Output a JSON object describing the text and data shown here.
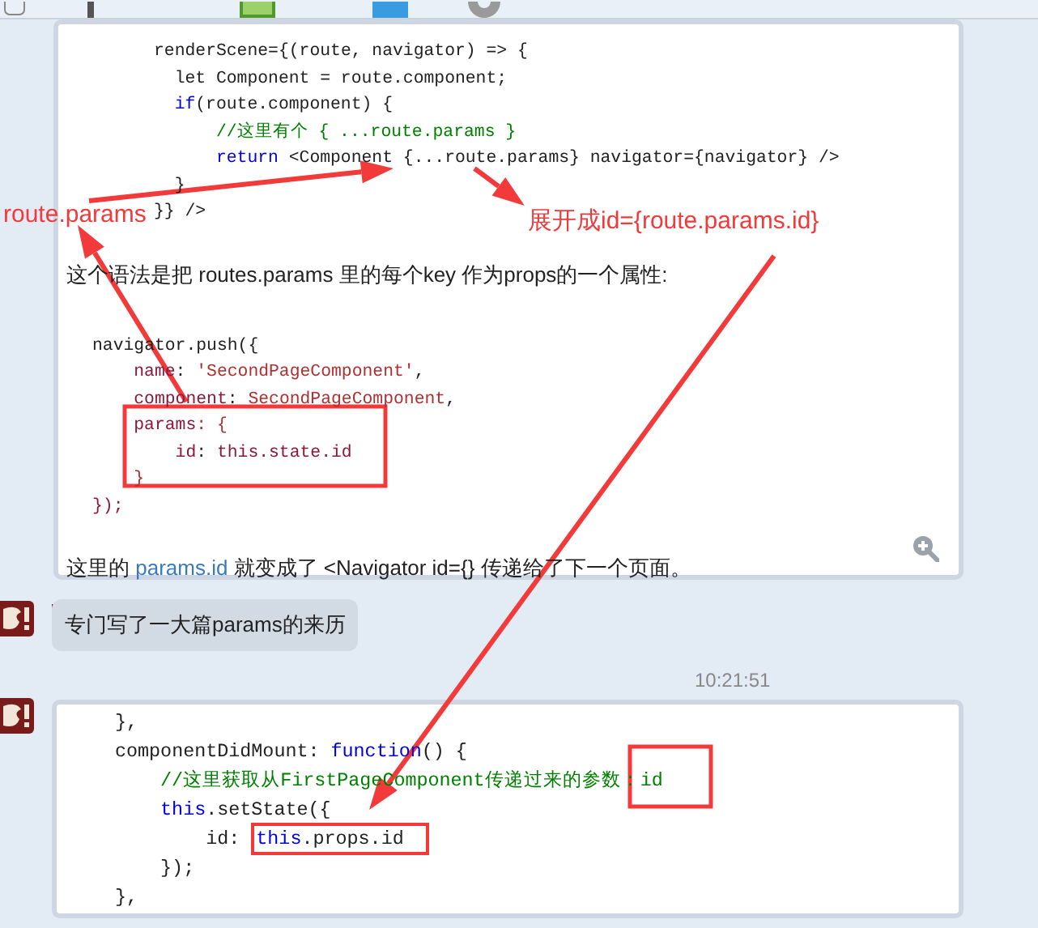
{
  "messages": [
    {
      "kind": "card",
      "blocks": [
        {
          "kind": "code",
          "lines": [
            [
              {
                "text": "renderScene={(route, navigator) => {",
                "kind": "plain"
              }
            ],
            [
              {
                "text": "  let Component = route.component;",
                "kind": "plain"
              }
            ],
            [
              {
                "text": "  if",
                "kind": "keyword"
              },
              {
                "text": "(route.component) {",
                "kind": "plain"
              }
            ],
            [
              {
                "text": "      //这里有个 { ...route.params }",
                "kind": "comment"
              }
            ],
            [
              {
                "text": "      return",
                "kind": "keyword"
              },
              {
                "text": " <Component {...route.params} navigator={navigator} />",
                "kind": "plain"
              }
            ],
            [
              {
                "text": "  }",
                "kind": "plain"
              }
            ],
            [
              {
                "text": "}} />",
                "kind": "plain"
              }
            ]
          ]
        },
        {
          "kind": "text",
          "parts": [
            {
              "text": "这个语法是把 routes.params 里的每个key 作为props的一个属性:",
              "kind": "plain"
            }
          ]
        },
        {
          "kind": "code2",
          "lines": [
            [
              {
                "text": "navigator.push({",
                "kind": "plain"
              }
            ],
            [
              {
                "text": "    name",
                "kind": "prop"
              },
              {
                "text": ": ",
                "kind": "plain"
              },
              {
                "text": "'SecondPageComponent'",
                "kind": "string"
              },
              {
                "text": ",",
                "kind": "plain"
              }
            ],
            [
              {
                "text": "    component",
                "kind": "prop"
              },
              {
                "text": ": ",
                "kind": "plain"
              },
              {
                "text": "SecondPageComponent",
                "kind": "string"
              },
              {
                "text": ",",
                "kind": "plain"
              }
            ],
            [
              {
                "text": "    params",
                "kind": "prop"
              },
              {
                "text": ": {",
                "kind": "string"
              }
            ],
            [
              {
                "text": "        id",
                "kind": "prop"
              },
              {
                "text": ": ",
                "kind": "plain"
              },
              {
                "text": "this.state.id",
                "kind": "prop"
              }
            ],
            [
              {
                "text": "    }",
                "kind": "string"
              }
            ],
            [
              {
                "text": "});",
                "kind": "prop"
              }
            ]
          ]
        },
        {
          "kind": "text",
          "parts": [
            {
              "text": "这里的 ",
              "kind": "plain"
            },
            {
              "text": "params.id",
              "kind": "link"
            },
            {
              "text": " 就变成了 <Navigator id={} 传递给了下一个页面。",
              "kind": "plain"
            }
          ]
        }
      ]
    },
    {
      "kind": "bubble",
      "text": "专门写了一大篇params的来历"
    },
    {
      "kind": "time",
      "text": "10:21:51"
    },
    {
      "kind": "card3",
      "blocks": [
        {
          "kind": "code3",
          "lines": [
            [
              {
                "text": "},",
                "kind": "plain"
              }
            ],
            [
              {
                "text": "componentDidMount: ",
                "kind": "plain"
              },
              {
                "text": "function",
                "kind": "keyword"
              },
              {
                "text": "() {",
                "kind": "plain"
              }
            ],
            [
              {
                "text": "    //这里获取从FirstPageComponent传递过来的参数：id",
                "kind": "comment"
              }
            ],
            [
              {
                "text": "    this",
                "kind": "keyword"
              },
              {
                "text": ".setState({",
                "kind": "plain"
              }
            ],
            [
              {
                "text": "        id: ",
                "kind": "plain",
                "highlighted": false
              },
              {
                "text": "this",
                "kind": "keyword",
                "highlighted": true
              },
              {
                "text": ".props.id",
                "kind": "plain",
                "highlighted": true
              }
            ],
            [
              {
                "text": "    });",
                "kind": "plain"
              }
            ],
            [
              {
                "text": "},",
                "kind": "plain"
              }
            ]
          ]
        }
      ]
    }
  ],
  "annotations": [
    {
      "text": "route.params"
    },
    {
      "text": "展开成id={route.params.id}"
    }
  ]
}
